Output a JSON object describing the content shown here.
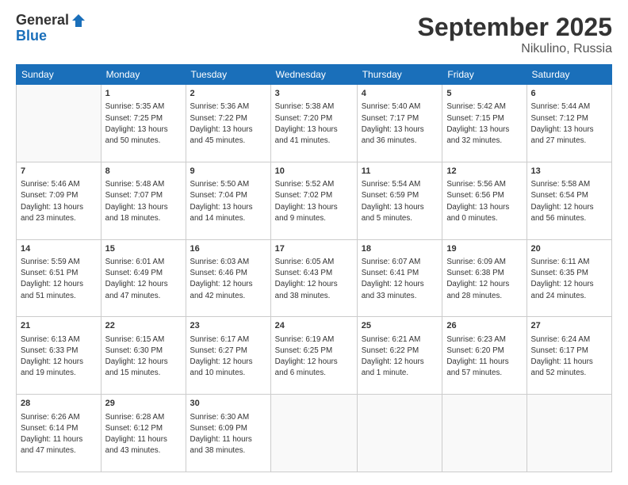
{
  "header": {
    "logo_line1": "General",
    "logo_line2": "Blue",
    "month_title": "September 2025",
    "location": "Nikulino, Russia"
  },
  "weekdays": [
    "Sunday",
    "Monday",
    "Tuesday",
    "Wednesday",
    "Thursday",
    "Friday",
    "Saturday"
  ],
  "weeks": [
    [
      {
        "day": "",
        "info": ""
      },
      {
        "day": "1",
        "info": "Sunrise: 5:35 AM\nSunset: 7:25 PM\nDaylight: 13 hours\nand 50 minutes."
      },
      {
        "day": "2",
        "info": "Sunrise: 5:36 AM\nSunset: 7:22 PM\nDaylight: 13 hours\nand 45 minutes."
      },
      {
        "day": "3",
        "info": "Sunrise: 5:38 AM\nSunset: 7:20 PM\nDaylight: 13 hours\nand 41 minutes."
      },
      {
        "day": "4",
        "info": "Sunrise: 5:40 AM\nSunset: 7:17 PM\nDaylight: 13 hours\nand 36 minutes."
      },
      {
        "day": "5",
        "info": "Sunrise: 5:42 AM\nSunset: 7:15 PM\nDaylight: 13 hours\nand 32 minutes."
      },
      {
        "day": "6",
        "info": "Sunrise: 5:44 AM\nSunset: 7:12 PM\nDaylight: 13 hours\nand 27 minutes."
      }
    ],
    [
      {
        "day": "7",
        "info": "Sunrise: 5:46 AM\nSunset: 7:09 PM\nDaylight: 13 hours\nand 23 minutes."
      },
      {
        "day": "8",
        "info": "Sunrise: 5:48 AM\nSunset: 7:07 PM\nDaylight: 13 hours\nand 18 minutes."
      },
      {
        "day": "9",
        "info": "Sunrise: 5:50 AM\nSunset: 7:04 PM\nDaylight: 13 hours\nand 14 minutes."
      },
      {
        "day": "10",
        "info": "Sunrise: 5:52 AM\nSunset: 7:02 PM\nDaylight: 13 hours\nand 9 minutes."
      },
      {
        "day": "11",
        "info": "Sunrise: 5:54 AM\nSunset: 6:59 PM\nDaylight: 13 hours\nand 5 minutes."
      },
      {
        "day": "12",
        "info": "Sunrise: 5:56 AM\nSunset: 6:56 PM\nDaylight: 13 hours\nand 0 minutes."
      },
      {
        "day": "13",
        "info": "Sunrise: 5:58 AM\nSunset: 6:54 PM\nDaylight: 12 hours\nand 56 minutes."
      }
    ],
    [
      {
        "day": "14",
        "info": "Sunrise: 5:59 AM\nSunset: 6:51 PM\nDaylight: 12 hours\nand 51 minutes."
      },
      {
        "day": "15",
        "info": "Sunrise: 6:01 AM\nSunset: 6:49 PM\nDaylight: 12 hours\nand 47 minutes."
      },
      {
        "day": "16",
        "info": "Sunrise: 6:03 AM\nSunset: 6:46 PM\nDaylight: 12 hours\nand 42 minutes."
      },
      {
        "day": "17",
        "info": "Sunrise: 6:05 AM\nSunset: 6:43 PM\nDaylight: 12 hours\nand 38 minutes."
      },
      {
        "day": "18",
        "info": "Sunrise: 6:07 AM\nSunset: 6:41 PM\nDaylight: 12 hours\nand 33 minutes."
      },
      {
        "day": "19",
        "info": "Sunrise: 6:09 AM\nSunset: 6:38 PM\nDaylight: 12 hours\nand 28 minutes."
      },
      {
        "day": "20",
        "info": "Sunrise: 6:11 AM\nSunset: 6:35 PM\nDaylight: 12 hours\nand 24 minutes."
      }
    ],
    [
      {
        "day": "21",
        "info": "Sunrise: 6:13 AM\nSunset: 6:33 PM\nDaylight: 12 hours\nand 19 minutes."
      },
      {
        "day": "22",
        "info": "Sunrise: 6:15 AM\nSunset: 6:30 PM\nDaylight: 12 hours\nand 15 minutes."
      },
      {
        "day": "23",
        "info": "Sunrise: 6:17 AM\nSunset: 6:27 PM\nDaylight: 12 hours\nand 10 minutes."
      },
      {
        "day": "24",
        "info": "Sunrise: 6:19 AM\nSunset: 6:25 PM\nDaylight: 12 hours\nand 6 minutes."
      },
      {
        "day": "25",
        "info": "Sunrise: 6:21 AM\nSunset: 6:22 PM\nDaylight: 12 hours\nand 1 minute."
      },
      {
        "day": "26",
        "info": "Sunrise: 6:23 AM\nSunset: 6:20 PM\nDaylight: 11 hours\nand 57 minutes."
      },
      {
        "day": "27",
        "info": "Sunrise: 6:24 AM\nSunset: 6:17 PM\nDaylight: 11 hours\nand 52 minutes."
      }
    ],
    [
      {
        "day": "28",
        "info": "Sunrise: 6:26 AM\nSunset: 6:14 PM\nDaylight: 11 hours\nand 47 minutes."
      },
      {
        "day": "29",
        "info": "Sunrise: 6:28 AM\nSunset: 6:12 PM\nDaylight: 11 hours\nand 43 minutes."
      },
      {
        "day": "30",
        "info": "Sunrise: 6:30 AM\nSunset: 6:09 PM\nDaylight: 11 hours\nand 38 minutes."
      },
      {
        "day": "",
        "info": ""
      },
      {
        "day": "",
        "info": ""
      },
      {
        "day": "",
        "info": ""
      },
      {
        "day": "",
        "info": ""
      }
    ]
  ]
}
